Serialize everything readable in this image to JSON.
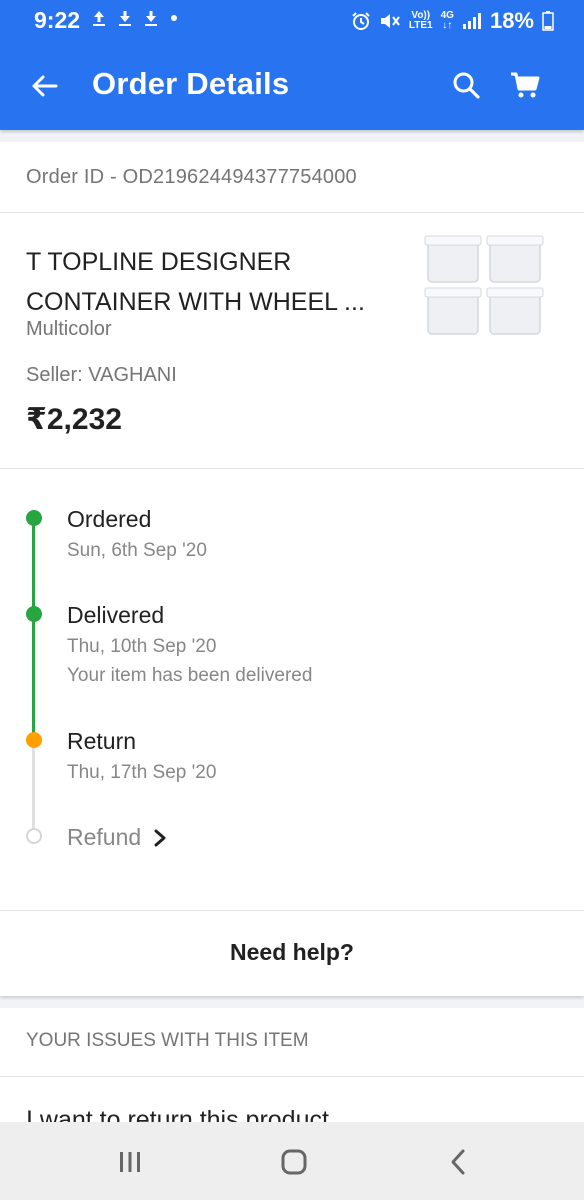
{
  "status_bar": {
    "time": "9:22",
    "network_vo": "Vo))",
    "network_lte": "LTE1",
    "network_4g": "4G",
    "battery_percent": "18%",
    "icons": [
      "upload-icon",
      "download-icon",
      "download-icon",
      "dot-icon",
      "alarm-icon",
      "mute-icon",
      "signal-icon",
      "battery-icon"
    ]
  },
  "app_bar": {
    "title": "Order Details",
    "color": "#2874f0"
  },
  "order": {
    "id_text": "Order ID - OD219624494377754000",
    "product": {
      "title": "T TOPLINE DESIGNER CONTAINER WITH WHEEL ...",
      "variant": "Multicolor",
      "seller": "Seller: VAGHANI",
      "price": "₹2,232"
    }
  },
  "timeline": {
    "steps": [
      {
        "label": "Ordered",
        "date": "Sun, 6th Sep '20",
        "status": "done",
        "color": "#26a541"
      },
      {
        "label": "Delivered",
        "date": "Thu, 10th Sep '20",
        "note": "Your item has been delivered",
        "status": "done",
        "color": "#26a541"
      },
      {
        "label": "Return",
        "date": "Thu, 17th Sep '20",
        "status": "current",
        "color": "#ff9f00"
      },
      {
        "label": "Refund",
        "status": "pending",
        "color": "#dddddd"
      }
    ]
  },
  "help": {
    "label": "Need help?"
  },
  "issues": {
    "header": "YOUR ISSUES WITH THIS ITEM",
    "items": [
      "I want to return this product"
    ]
  },
  "nav_bar": {
    "buttons": [
      "recents-icon",
      "home-icon",
      "back-icon"
    ]
  }
}
